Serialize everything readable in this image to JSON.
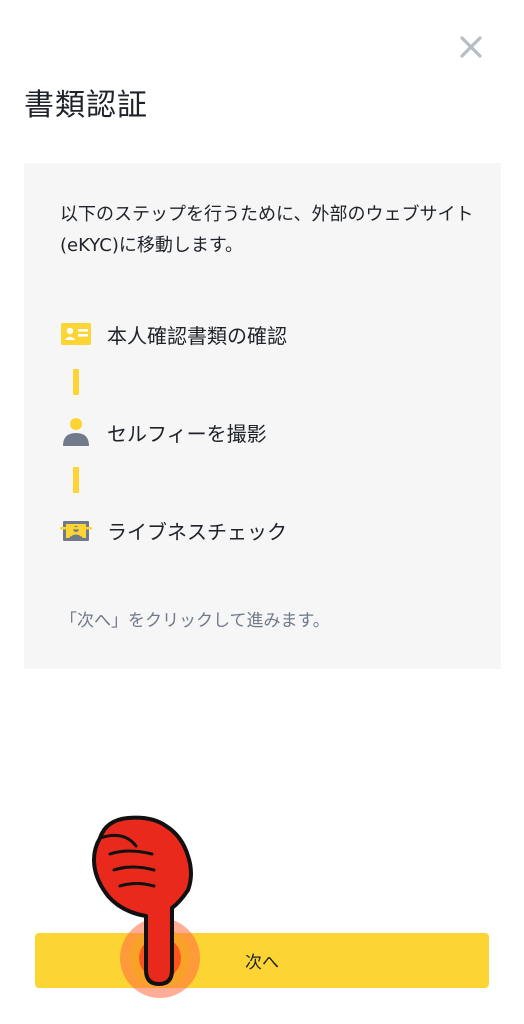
{
  "header": {
    "title": "書類認証",
    "close_icon": "close-icon"
  },
  "card": {
    "intro": "以下のステップを行うために、外部のウェブサイト(eKYC)に移動します。",
    "steps": [
      {
        "icon": "id-card-icon",
        "label": "本人確認書類の確認"
      },
      {
        "icon": "person-icon",
        "label": "セルフィーを撮影"
      },
      {
        "icon": "face-scan-icon",
        "label": "ライブネスチェック"
      }
    ],
    "hint": "「次へ」をクリックして進みます。"
  },
  "footer": {
    "next_label": "次へ"
  },
  "colors": {
    "accent": "#fcd535",
    "text_primary": "#1e2329",
    "text_secondary": "#707a8a",
    "card_background": "#f6f6f6",
    "pointer_red": "#e8291c"
  }
}
